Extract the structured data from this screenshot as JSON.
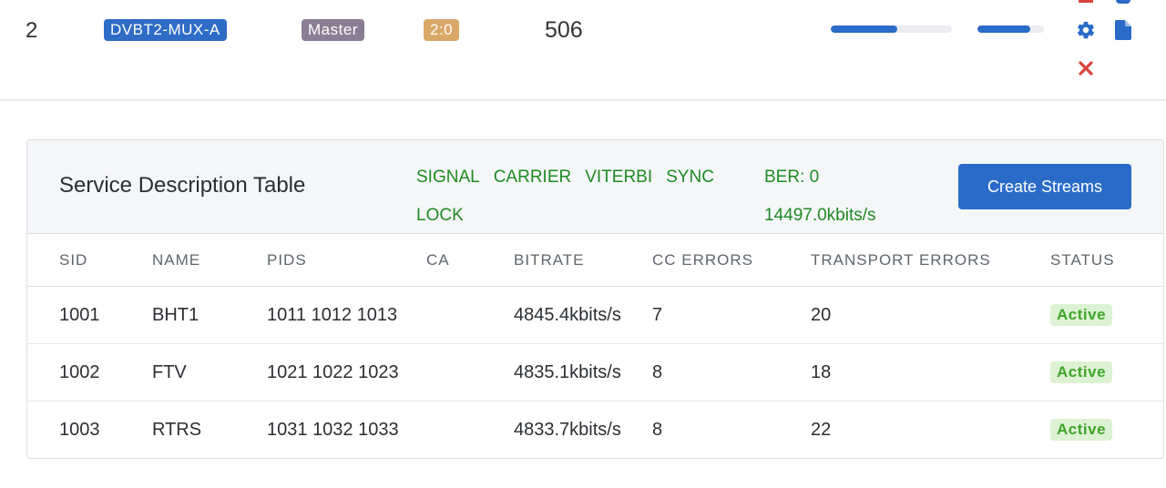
{
  "adapter": {
    "number": "2",
    "name": "DVBT2-MUX-A",
    "role": "Master",
    "ratio": "2:0",
    "frequency": "506",
    "bar1_fill": 0.55,
    "bar2_fill": 0.79,
    "icons": [
      "gear-icon",
      "file-icon",
      "close-icon"
    ],
    "colors": {
      "name_badge": "#2f6cc6",
      "role_badge": "#8b7d94",
      "ratio_badge": "#d9a868",
      "bar": "#2a6bc8",
      "close": "#d9443c"
    }
  },
  "card": {
    "title": "Service Description Table",
    "flags": [
      "SIGNAL",
      "CARRIER",
      "VITERBI",
      "SYNC",
      "LOCK"
    ],
    "ber": "BER: 0",
    "bitrate": "14497.0kbits/s",
    "create_label": "Create Streams",
    "colors": {
      "ok_text": "#1f8a23",
      "primary": "#2a6bc8",
      "active_bg": "#ddf2d4",
      "active_text": "#3fa52b"
    }
  },
  "table": {
    "headers": [
      "SID",
      "NAME",
      "PIDS",
      "CA",
      "BITRATE",
      "CC ERRORS",
      "TRANSPORT ERRORS",
      "STATUS"
    ],
    "rows": [
      {
        "sid": "1001",
        "name": "BHT1",
        "pids": "1011 1012 1013",
        "ca": "",
        "bitrate": "4845.4kbits/s",
        "cc": "7",
        "te": "20",
        "status": "Active"
      },
      {
        "sid": "1002",
        "name": "FTV",
        "pids": "1021 1022 1023",
        "ca": "",
        "bitrate": "4835.1kbits/s",
        "cc": "8",
        "te": "18",
        "status": "Active"
      },
      {
        "sid": "1003",
        "name": "RTRS",
        "pids": "1031 1032 1033",
        "ca": "",
        "bitrate": "4833.7kbits/s",
        "cc": "8",
        "te": "22",
        "status": "Active"
      }
    ]
  }
}
